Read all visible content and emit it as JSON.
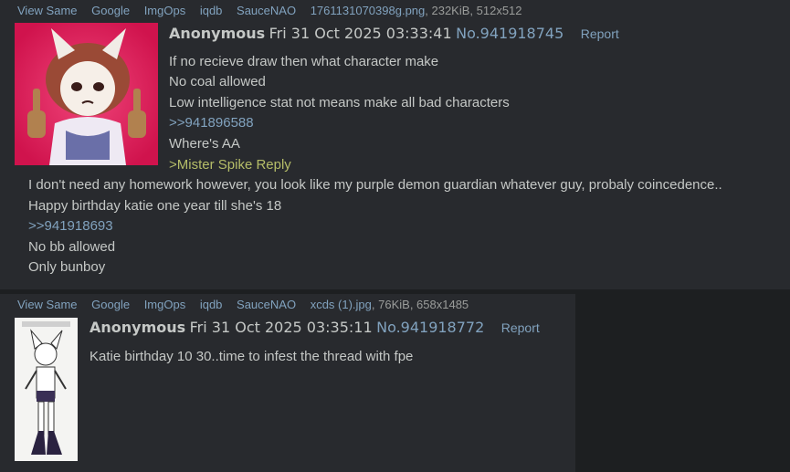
{
  "post1": {
    "file": {
      "actions": [
        "View Same",
        "Google",
        "ImgOps",
        "iqdb",
        "SauceNAO"
      ],
      "filename": "1761131070398g.png",
      "meta": ", 232KiB, 512x512"
    },
    "name": "Anonymous",
    "date": "Fri 31 Oct 2025 03:33:41",
    "number": "No.941918745",
    "report": "Report",
    "lines": [
      {
        "text": "If no recieve draw then what character make",
        "kind": "text"
      },
      {
        "text": "No coal allowed",
        "kind": "text"
      },
      {
        "text": "Low intelligence stat not means make all bad characters",
        "kind": "text"
      },
      {
        "text": ">>941896588",
        "kind": "quotelink"
      },
      {
        "text": "Where's AA",
        "kind": "text"
      },
      {
        "text": ">Mister Spike Reply",
        "kind": "greentext"
      },
      {
        "text": "I don't need any homework however, you look like my purple demon guardian whatever guy, probaly coincedence..",
        "kind": "text"
      },
      {
        "text": "Happy birthday katie one year till she's 18",
        "kind": "text"
      },
      {
        "text": ">>941918693",
        "kind": "quotelink"
      },
      {
        "text": "No bb allowed",
        "kind": "text"
      },
      {
        "text": "Only bunboy",
        "kind": "text"
      }
    ]
  },
  "post2": {
    "file": {
      "actions": [
        "View Same",
        "Google",
        "ImgOps",
        "iqdb",
        "SauceNAO"
      ],
      "filename": "xcds (1).jpg",
      "meta": ", 76KiB, 658x1485"
    },
    "name": "Anonymous",
    "date": "Fri 31 Oct 2025 03:35:11",
    "number": "No.941918772",
    "report": "Report",
    "lines": [
      {
        "text": "Katie birthday 10 30..time to infest the thread with fpe",
        "kind": "text"
      }
    ]
  },
  "colors": {
    "background": "#1d1f21",
    "post_background": "#282a2e",
    "text": "#c5c8c6",
    "link": "#81a2be",
    "greentext": "#b5bd68"
  }
}
